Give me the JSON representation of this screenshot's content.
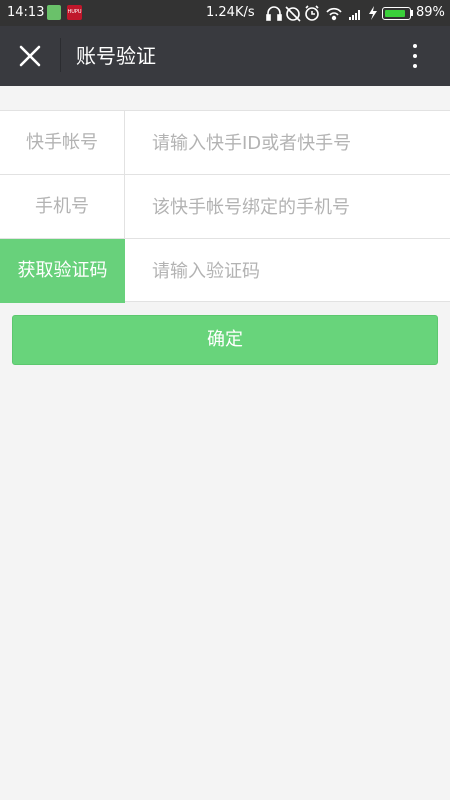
{
  "status_bar": {
    "time": "14:13",
    "app_icon_text": "HUPU",
    "network_speed": "1.24K/s",
    "battery_percent": "89%",
    "battery_level": 0.89,
    "icons": [
      "headset-icon",
      "alarm-off-icon",
      "alarm-icon",
      "wifi-icon",
      "signal-icon",
      "charging-icon",
      "battery-icon"
    ]
  },
  "title_bar": {
    "title": "账号验证",
    "close_icon": "close-icon",
    "menu_icon": "more-vertical-icon"
  },
  "form": {
    "rows": [
      {
        "label": "快手帐号",
        "placeholder": "请输入快手ID或者快手号"
      },
      {
        "label": "手机号",
        "placeholder": "该快手帐号绑定的手机号"
      },
      {
        "label": "获取验证码",
        "placeholder": "请输入验证码"
      }
    ]
  },
  "confirm_button": {
    "label": "确定"
  },
  "colors": {
    "accent": "#68d17b",
    "title_bar": "#393a3f",
    "status_bar": "#333333",
    "background": "#f4f4f4"
  }
}
